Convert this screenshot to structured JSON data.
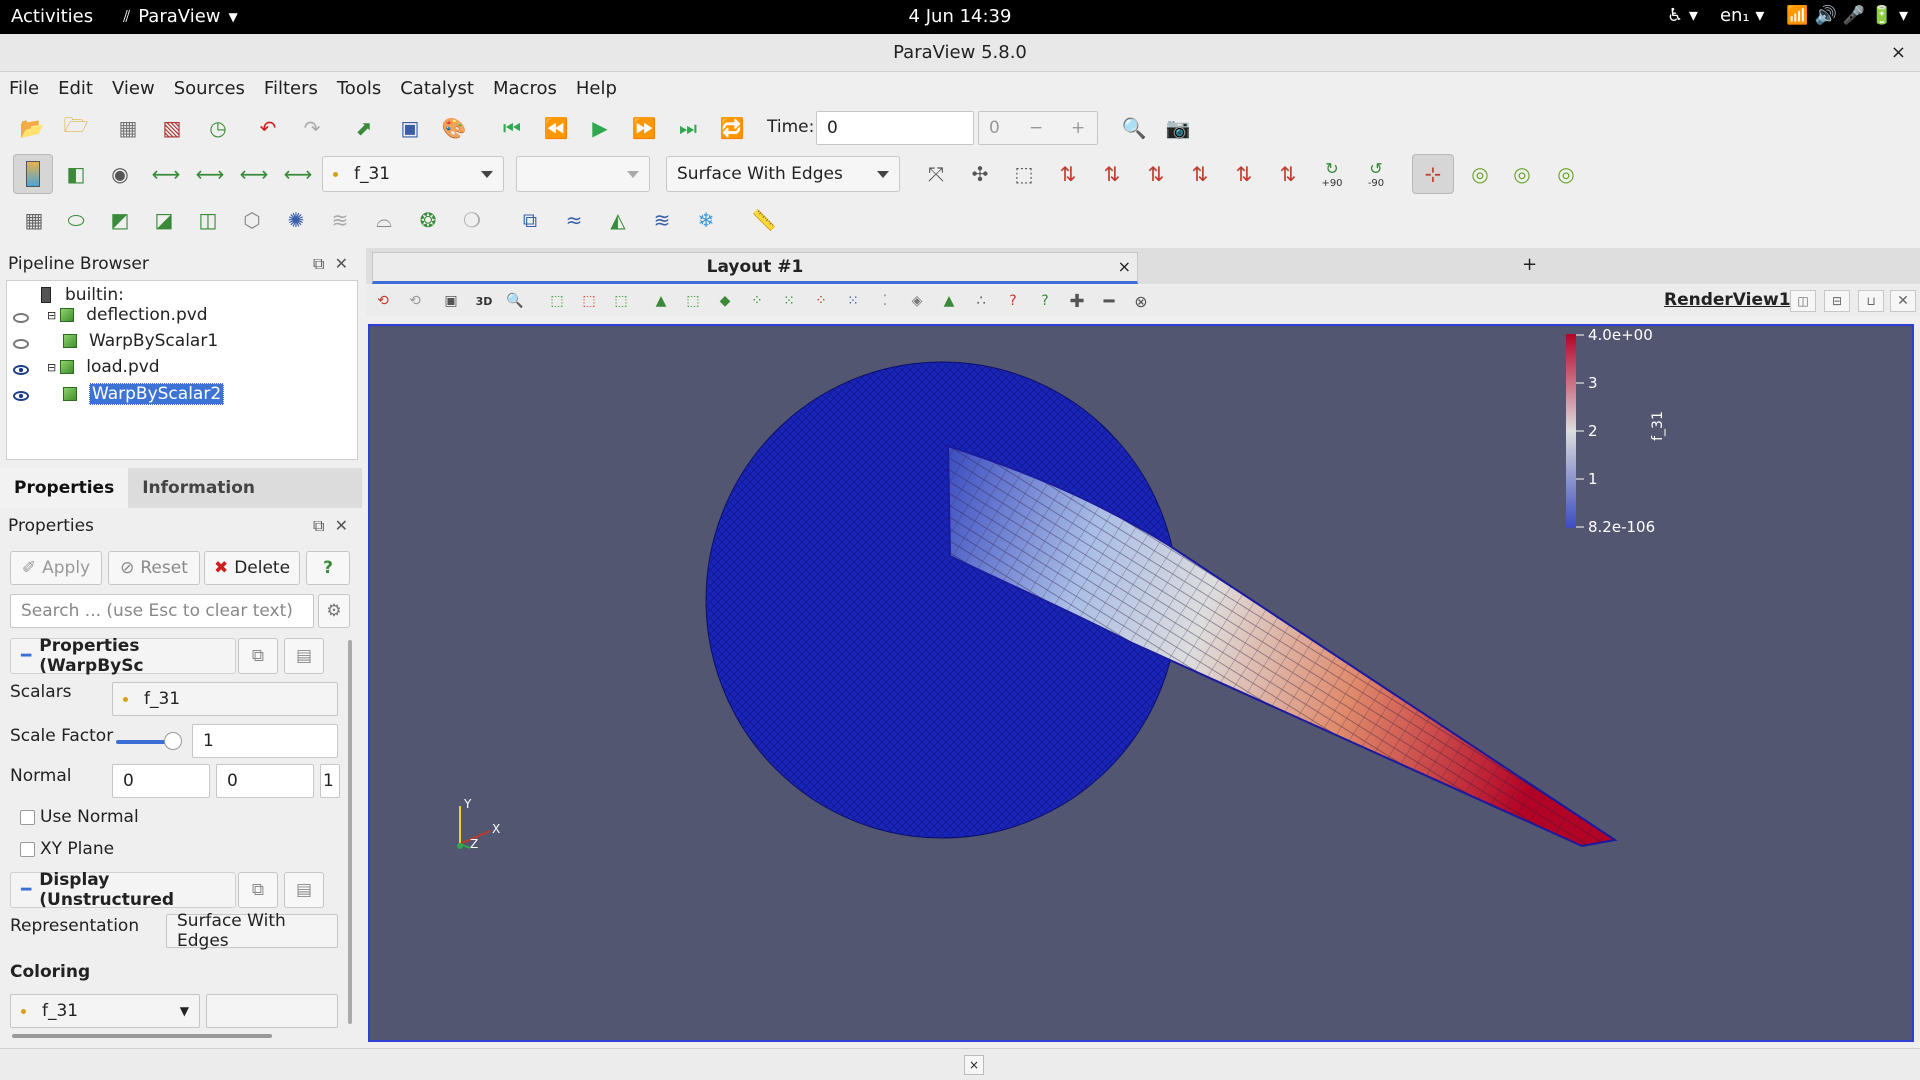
{
  "system_bar": {
    "activities": "Activities",
    "app_name": "ParaView",
    "clock": "4 Jun  14:39",
    "language": "en₁"
  },
  "window": {
    "title": "ParaView 5.8.0",
    "close": "×"
  },
  "menu": [
    "File",
    "Edit",
    "View",
    "Sources",
    "Filters",
    "Tools",
    "Catalyst",
    "Macros",
    "Help"
  ],
  "toolbar": {
    "time_label": "Time:",
    "time_value": "0",
    "timestep_value": "0",
    "minus": "−",
    "plus": "+",
    "array_combo": "f_31",
    "component_combo": "",
    "representation_combo": "Surface With Edges",
    "rot_plus": "+90",
    "rot_minus": "-90",
    "icons": {
      "open": "open-icon",
      "save": "save-icon",
      "undo": "undo-icon",
      "redo": "redo-icon",
      "first": "first-frame-icon",
      "prev": "prev-frame-icon",
      "play": "play-icon",
      "next": "next-frame-icon",
      "last": "last-frame-icon",
      "loop": "loop-icon"
    }
  },
  "pipeline": {
    "title": "Pipeline Browser",
    "items": [
      {
        "label": "builtin:"
      },
      {
        "label": "deflection.pvd"
      },
      {
        "label": "WarpByScalar1"
      },
      {
        "label": "load.pvd"
      },
      {
        "label": "WarpByScalar2"
      }
    ]
  },
  "prop_tabs": {
    "properties": "Properties",
    "information": "Information"
  },
  "properties": {
    "title": "Properties",
    "apply": "Apply",
    "reset": "Reset",
    "delete": "Delete",
    "help": "?",
    "search_placeholder": "Search ... (use Esc to clear text)",
    "section_props": "Properties (WarpBySc",
    "scalars_label": "Scalars",
    "scalars_value": "f_31",
    "scale_factor_label": "Scale Factor",
    "scale_factor_value": "1",
    "normal_label": "Normal",
    "normal_x": "0",
    "normal_y": "0",
    "normal_z": "1",
    "use_normal": "Use Normal",
    "xy_plane": "XY Plane",
    "section_display": "Display (Unstructured",
    "representation_label": "Representation",
    "representation_value": "Surface With Edges",
    "coloring_label": "Coloring",
    "coloring_value": "f_31"
  },
  "layout": {
    "tab_label": "Layout #1",
    "add": "+",
    "close": "×"
  },
  "view": {
    "name": "RenderView1",
    "btn_3d": "3D"
  },
  "colorbar": {
    "title": "f_31",
    "ticks": [
      "4.0e+00",
      "3",
      "2",
      "1",
      "8.2e-106"
    ],
    "colors": {
      "max": "#b40426",
      "mid": "#dddddd",
      "min": "#3b4cc0"
    }
  },
  "axes": {
    "x": "X",
    "y": "Y",
    "z": "Z"
  },
  "statusbar": {
    "close": "×"
  }
}
